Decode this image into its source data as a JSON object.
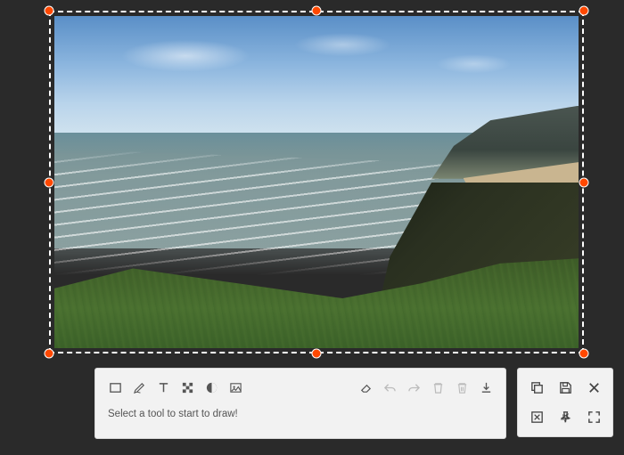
{
  "hint_text": "Select a tool to start to draw!",
  "toolbar": {
    "left": {
      "rect": "rectangle-tool",
      "pencil": "pencil-tool",
      "text": "text-tool",
      "pixelate": "pixelate-tool",
      "invert": "invert-tool",
      "image": "image-tool"
    },
    "right": {
      "eraser": "eraser-tool",
      "undo": "undo",
      "redo": "redo",
      "delete": "delete",
      "clear": "clear-all",
      "download": "download"
    }
  },
  "side": {
    "copy": "copy",
    "save": "save",
    "close": "close",
    "discard": "discard",
    "pin": "pin",
    "fullscreen": "fullscreen"
  },
  "colors": {
    "handle": "#ff4800",
    "panel_bg": "#f2f2f2"
  }
}
